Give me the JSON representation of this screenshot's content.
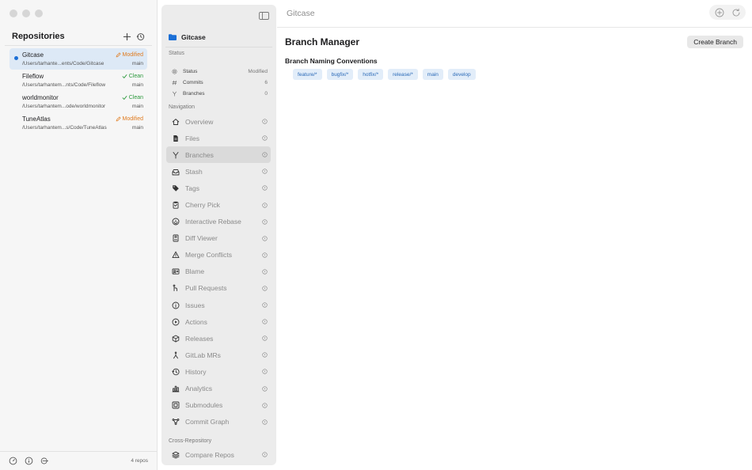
{
  "app": {
    "title": "Gitcase"
  },
  "repos_panel": {
    "title": "Repositories",
    "repos": [
      {
        "name": "Gitcase",
        "path": "/Users/tarhante...ents/Code/Gitcase",
        "status": "Modified",
        "status_kind": "modified",
        "branch": "main",
        "active": true
      },
      {
        "name": "Fileflow",
        "path": "/Users/tarhantem...nts/Code/Fileflow",
        "status": "Clean",
        "status_kind": "clean",
        "branch": "main",
        "active": false
      },
      {
        "name": "worldmonitor",
        "path": "/Users/tarhantem...ode/worldmonitor",
        "status": "Clean",
        "status_kind": "clean",
        "branch": "main",
        "active": false
      },
      {
        "name": "TuneAtlas",
        "path": "/Users/tarhantem...s/Code/TuneAtlas",
        "status": "Modified",
        "status_kind": "modified",
        "branch": "main",
        "active": false
      }
    ],
    "footer_count": "4 repos"
  },
  "nav_panel": {
    "repo_name": "Gitcase",
    "status_section": "Status",
    "status_rows": [
      {
        "label": "Status",
        "value": "Modified",
        "icon": "gear-icon"
      },
      {
        "label": "Commits",
        "value": "6",
        "icon": "hash-icon"
      },
      {
        "label": "Branches",
        "value": "0",
        "icon": "branch-icon"
      }
    ],
    "navigation_section": "Navigation",
    "nav_items": [
      {
        "label": "Overview",
        "icon": "house-icon"
      },
      {
        "label": "Files",
        "icon": "document-icon"
      },
      {
        "label": "Branches",
        "icon": "branch-icon",
        "active": true
      },
      {
        "label": "Stash",
        "icon": "tray-icon"
      },
      {
        "label": "Tags",
        "icon": "tag-icon"
      },
      {
        "label": "Cherry Pick",
        "icon": "clipboard-icon"
      },
      {
        "label": "Interactive Rebase",
        "icon": "rebase-icon"
      },
      {
        "label": "Diff Viewer",
        "icon": "diff-icon"
      },
      {
        "label": "Merge Conflicts",
        "icon": "warning-icon"
      },
      {
        "label": "Blame",
        "icon": "person-card-icon"
      },
      {
        "label": "Pull Requests",
        "icon": "pull-request-icon"
      },
      {
        "label": "Issues",
        "icon": "info-circle-icon"
      },
      {
        "label": "Actions",
        "icon": "play-circle-icon"
      },
      {
        "label": "Releases",
        "icon": "package-icon"
      },
      {
        "label": "GitLab MRs",
        "icon": "merge-icon"
      },
      {
        "label": "History",
        "icon": "clock-icon"
      },
      {
        "label": "Analytics",
        "icon": "bar-chart-icon"
      },
      {
        "label": "Submodules",
        "icon": "submodule-icon"
      },
      {
        "label": "Commit Graph",
        "icon": "graph-icon"
      }
    ],
    "cross_section": "Cross-Repository",
    "cross_items": [
      {
        "label": "Compare Repos",
        "icon": "stack-icon"
      }
    ]
  },
  "main": {
    "title": "Branch Manager",
    "create_label": "Create Branch",
    "conventions_title": "Branch Naming Conventions",
    "conventions": [
      "feature/*",
      "bugfix/*",
      "hotfix/*",
      "release/*",
      "main",
      "develop"
    ]
  },
  "colors": {
    "accent": "#1b6fd6",
    "modified": "#e07b1f",
    "clean": "#2e9a3e",
    "chip_bg": "#e2edf9",
    "chip_text": "#2c6bb8"
  }
}
